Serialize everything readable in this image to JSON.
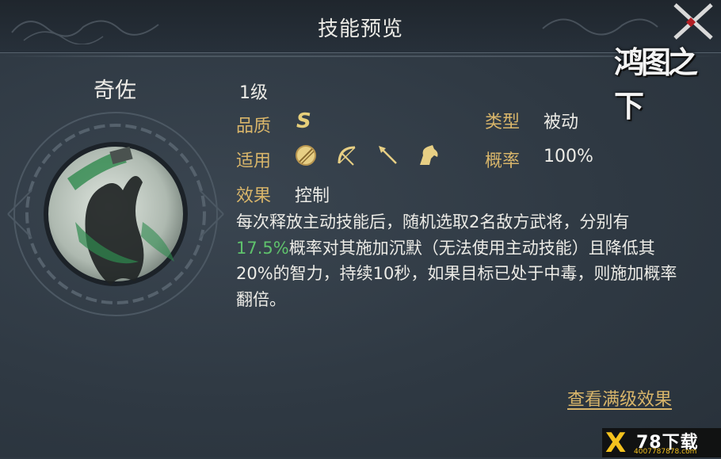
{
  "header": {
    "title": "技能预览"
  },
  "logo": {
    "text": "鸿图之下"
  },
  "skill": {
    "name": "奇佐",
    "level": "1级",
    "quality_label": "品质",
    "quality_value": "S",
    "type_label": "类型",
    "type_value": "被动",
    "applies_label": "适用",
    "applies_icons": [
      "shield-unit-icon",
      "bow-unit-icon",
      "spear-unit-icon",
      "cavalry-unit-icon"
    ],
    "chance_label": "概率",
    "chance_value": "100%",
    "effect_label": "效果",
    "effect_value": "控制",
    "description_pre": "每次释放主动技能后，随机选取2名敌方武将，分别有",
    "description_highlight": "17.5%",
    "description_post": "概率对其施加沉默（无法使用主动技能）且降低其20%的智力，持续10秒，如果目标已处于中毒，则施加概率翻倍。"
  },
  "actions": {
    "full_level_link": "查看满级效果"
  },
  "colors": {
    "label_gold": "#d8b56a",
    "highlight_green": "#5fc26c",
    "background": "#2f3943"
  }
}
